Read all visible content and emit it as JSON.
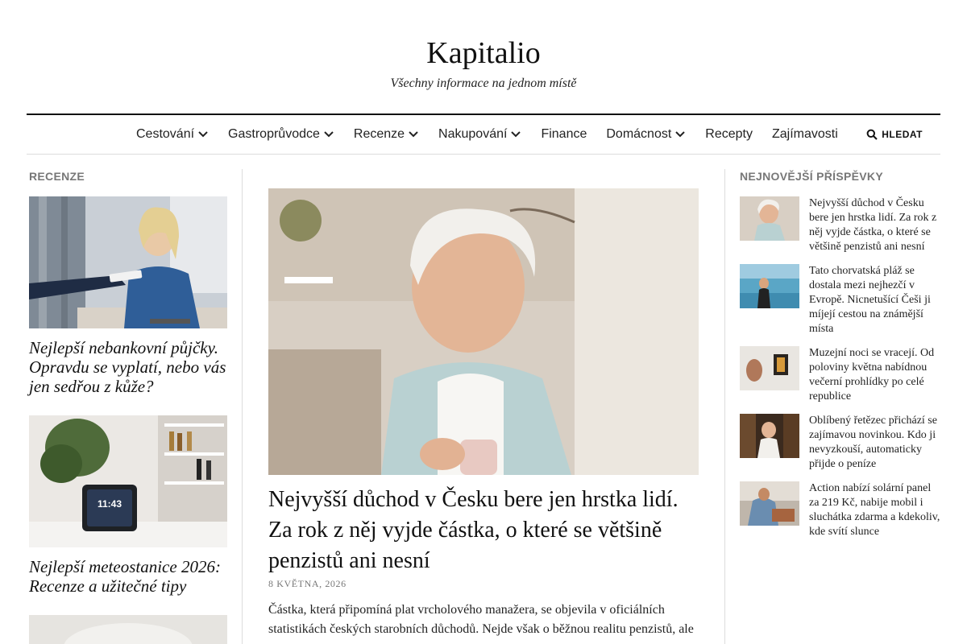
{
  "site": {
    "title": "Kapitalio",
    "tagline": "Všechny informace na jednom místě"
  },
  "nav": {
    "items": [
      {
        "label": "Cestování",
        "has_dropdown": true
      },
      {
        "label": "Gastroprůvodce",
        "has_dropdown": true
      },
      {
        "label": "Recenze",
        "has_dropdown": true
      },
      {
        "label": "Nakupování",
        "has_dropdown": true
      },
      {
        "label": "Finance",
        "has_dropdown": false
      },
      {
        "label": "Domácnost",
        "has_dropdown": true
      },
      {
        "label": "Recepty",
        "has_dropdown": false
      },
      {
        "label": "Zajímavosti",
        "has_dropdown": false
      }
    ],
    "search_label": "HLEDAT",
    "search_icon": "search-icon"
  },
  "left": {
    "section_label": "RECENZE",
    "cards": [
      {
        "title": "Nejlepší nebankovní půjčky. Opravdu se vyplatí, nebo vás jen sedřou z kůže?"
      },
      {
        "title": "Nejlepší meteostanice 2026: Recenze a užitečné tipy",
        "clock_text": "11:43"
      }
    ]
  },
  "main": {
    "title": "Nejvyšší důchod v Česku bere jen hrstka lidí. Za rok z něj vyjde částka, o které se většině penzistů ani nesní",
    "date": "8 KVĚTNA, 2026",
    "excerpt": "Částka, která připomíná plat vrcholového manažera, se objevila v oficiálních statistikách českých starobních důchodů. Nejde však o běžnou realitu penzistů, ale"
  },
  "right": {
    "section_label": "NEJNOVĚJŠÍ PŘÍSPĚVKY",
    "posts": [
      {
        "title": "Nejvyšší důchod v Česku bere jen hrstka lidí. Za rok z něj vyjde částka, o které se většině penzistů ani nesní"
      },
      {
        "title": "Tato chorvatská pláž se dostala mezi nejhezčí v Evropě. Nicnetušící Češi ji míjejí cestou na známější místa"
      },
      {
        "title": "Muzejní noci se vracejí. Od poloviny května nabídnou večerní prohlídky po celé republice"
      },
      {
        "title": "Oblíbený řetězec přichází se zajímavou novinkou. Kdo ji nevyzkouší, automaticky přijde o peníze"
      },
      {
        "title": "Action nabízí solární panel za 219 Kč, nabije mobil i sluchátka zdarma a kdekoliv, kde svítí slunce"
      }
    ]
  }
}
